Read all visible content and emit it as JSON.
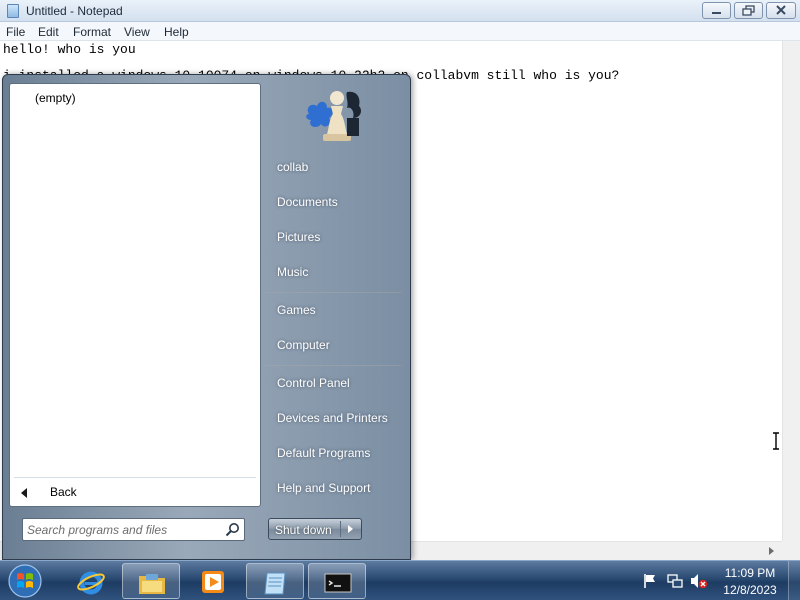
{
  "notepad": {
    "title": "Untitled - Notepad",
    "menu": [
      "File",
      "Edit",
      "Format",
      "View",
      "Help"
    ],
    "text_lines": [
      "hello! who is you",
      "i installed a windows 10 10074 on windows 10 22h2 on collabvm still who is you?"
    ]
  },
  "start_menu": {
    "programs_empty": "(empty)",
    "back_label": "Back",
    "search_placeholder": "Search programs and files",
    "right_items": [
      "collab",
      "Documents",
      "Pictures",
      "Music",
      "Games",
      "Computer",
      "Control Panel",
      "Devices and Printers",
      "Default Programs",
      "Help and Support"
    ],
    "shutdown_label": "Shut down"
  },
  "taskbar": {
    "pinned": [
      "internet-explorer-icon",
      "windows-explorer-icon",
      "media-player-icon",
      "notepad-icon",
      "command-prompt-icon"
    ],
    "clock_time": "11:09 PM",
    "clock_date": "12/8/2023"
  },
  "colors": {
    "taskbar": "#2a4a72",
    "start_menu_right": "#7b8ea3"
  }
}
